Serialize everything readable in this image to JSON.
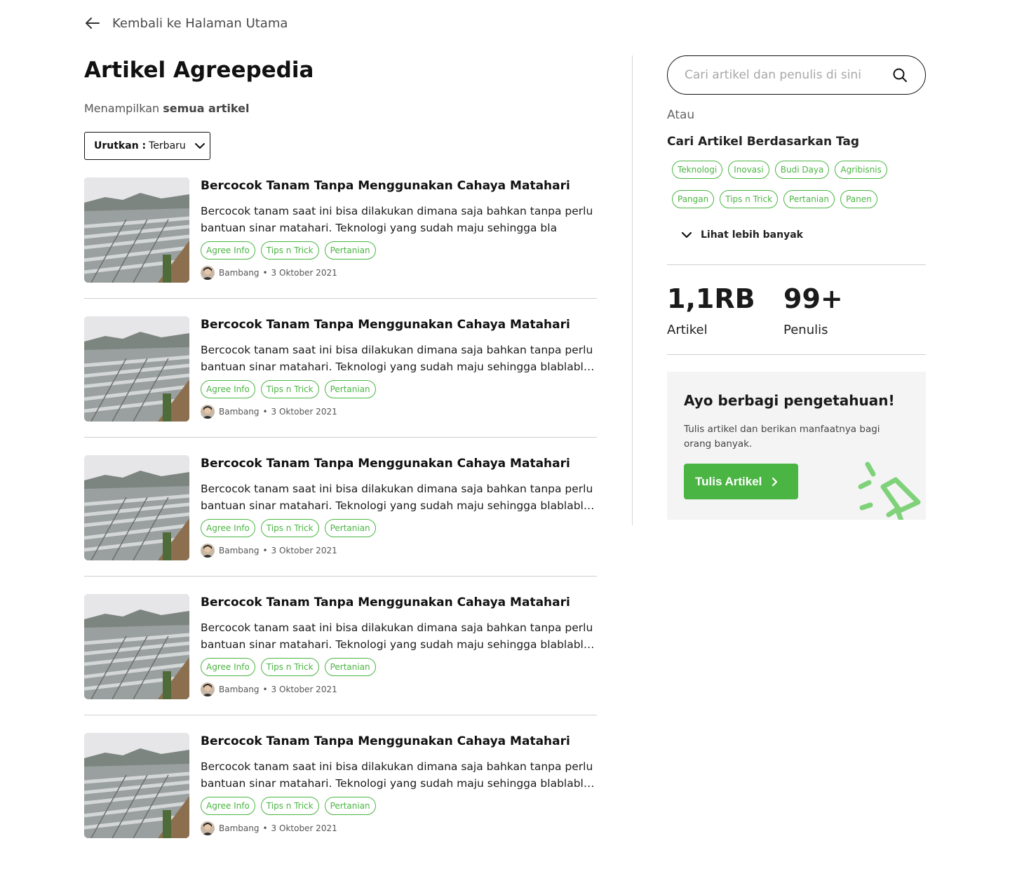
{
  "back": {
    "label": "Kembali ke Halaman Utama"
  },
  "page": {
    "title": "Artikel Agreepedia",
    "subtitle_prefix": "Menampilkan ",
    "subtitle_bold": "semua artikel"
  },
  "sort": {
    "label": "Urutkan :",
    "value": "Terbaru"
  },
  "articles": [
    {
      "title": "Bercocok Tanam Tanpa Menggunakan Cahaya Matahari",
      "excerpt_line1": "Bercocok tanam saat ini bisa dilakukan dimana saja bahkan tanpa perlu",
      "excerpt_line2": "bantuan sinar matahari. Teknologi yang sudah maju sehingga bla",
      "tags": [
        "Agree Info",
        "Tips n Trick",
        "Pertanian"
      ],
      "author": "Bambang",
      "date": "3 Oktober 2021"
    },
    {
      "title": "Bercocok Tanam Tanpa Menggunakan Cahaya Matahari",
      "excerpt_line1": "Bercocok tanam saat ini bisa dilakukan dimana saja bahkan tanpa perlu",
      "excerpt_line2": "bantuan sinar matahari. Teknologi yang sudah maju sehingga blablablabl...",
      "tags": [
        "Agree Info",
        "Tips n Trick",
        "Pertanian"
      ],
      "author": "Bambang",
      "date": "3 Oktober 2021"
    },
    {
      "title": "Bercocok Tanam Tanpa Menggunakan Cahaya Matahari",
      "excerpt_line1": "Bercocok tanam saat ini bisa dilakukan dimana saja bahkan tanpa perlu",
      "excerpt_line2": "bantuan sinar matahari. Teknologi yang sudah maju sehingga blablablabl...",
      "tags": [
        "Agree Info",
        "Tips n Trick",
        "Pertanian"
      ],
      "author": "Bambang",
      "date": "3 Oktober 2021"
    },
    {
      "title": "Bercocok Tanam Tanpa Menggunakan Cahaya Matahari",
      "excerpt_line1": "Bercocok tanam saat ini bisa dilakukan dimana saja bahkan tanpa perlu",
      "excerpt_line2": "bantuan sinar matahari. Teknologi yang sudah maju sehingga blablablabl...",
      "tags": [
        "Agree Info",
        "Tips n Trick",
        "Pertanian"
      ],
      "author": "Bambang",
      "date": "3 Oktober 2021"
    },
    {
      "title": "Bercocok Tanam Tanpa Menggunakan Cahaya Matahari",
      "excerpt_line1": "Bercocok tanam saat ini bisa dilakukan dimana saja bahkan tanpa perlu",
      "excerpt_line2": "bantuan sinar matahari. Teknologi yang sudah maju sehingga blablablabl...",
      "tags": [
        "Agree Info",
        "Tips n Trick",
        "Pertanian"
      ],
      "author": "Bambang",
      "date": "3 Oktober 2021"
    }
  ],
  "sidebar": {
    "search_placeholder": "Cari artikel dan penulis di sini",
    "or_label": "Atau",
    "tag_heading": "Cari Artikel Berdasarkan Tag",
    "tags": [
      "Teknologi",
      "Inovasi",
      "Budi Daya",
      "Agribisnis",
      "Pangan",
      "Tips n Trick",
      "Pertanian",
      "Panen"
    ],
    "more_label": "Lihat lebih banyak",
    "stats": [
      {
        "value": "1,1RB",
        "label": "Artikel"
      },
      {
        "value": "99+",
        "label": "Penulis"
      }
    ],
    "cta": {
      "title": "Ayo berbagi pengetahuan!",
      "text": "Tulis artikel dan berikan manfaatnya bagi orang banyak.",
      "button": "Tulis Artikel"
    }
  },
  "icons": {
    "back": "arrow-left-icon",
    "sort": "chevron-down-icon",
    "search": "search-icon",
    "more": "chevron-down-icon",
    "cta_button": "chevron-right-icon",
    "cta_illustration": "megaphone-icon"
  },
  "colors": {
    "accent": "#4bb543",
    "text": "#111111",
    "muted": "#666666",
    "cta_bg": "#f4f4f4"
  }
}
